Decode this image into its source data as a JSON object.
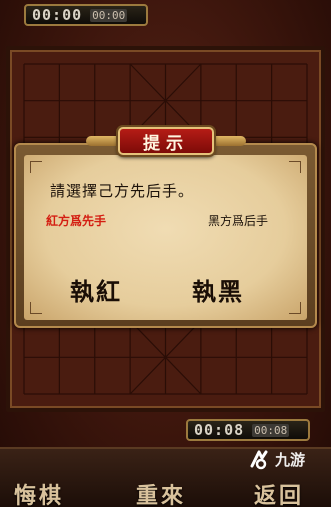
{
  "timers": {
    "top": {
      "total": "00:00",
      "step": "00:00"
    },
    "bottom": {
      "total": "00:08",
      "step": "00:08"
    }
  },
  "dialog": {
    "title": "提示",
    "prompt": "請選擇己方先后手。",
    "red_note": "紅方爲先手",
    "black_note": "黑方爲后手",
    "play_red": "執紅",
    "play_black": "執黑"
  },
  "toolbar": {
    "undo": "悔棋",
    "restart": "重來",
    "back": "返回"
  },
  "watermark": {
    "text": "九游"
  },
  "colors": {
    "dialog_title_bg": "#b51c16",
    "red_text": "#d41e12",
    "board_bg": "#4a1c10"
  }
}
